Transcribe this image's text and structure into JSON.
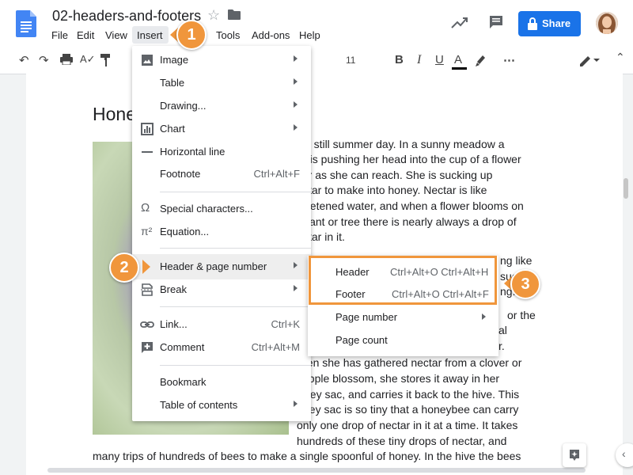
{
  "app": {
    "doc_title": "02-headers-and-footers",
    "share_label": "Share",
    "brand_color": "#1a73e8",
    "accent_color": "#f0963c"
  },
  "menubar": [
    "File",
    "Edit",
    "View",
    "Insert",
    "Tools",
    "Add-ons",
    "Help"
  ],
  "toolbar": {
    "font_size": "11"
  },
  "insert_menu": {
    "items": [
      {
        "label": "Image",
        "icon": "image-icon",
        "has_submenu": true
      },
      {
        "label": "Table",
        "icon": "",
        "has_submenu": true
      },
      {
        "label": "Drawing...",
        "icon": "",
        "has_submenu": true
      },
      {
        "label": "Chart",
        "icon": "chart-icon",
        "has_submenu": true
      },
      {
        "label": "Horizontal line",
        "icon": "horizontal-line-icon",
        "has_submenu": false
      },
      {
        "label": "Footnote",
        "icon": "",
        "shortcut": "Ctrl+Alt+F"
      },
      {
        "label": "Special characters...",
        "icon": "omega-icon"
      },
      {
        "label": "Equation...",
        "icon": "pi-icon"
      },
      {
        "label": "Header & page number",
        "icon": "",
        "has_submenu": true,
        "highlighted": true
      },
      {
        "label": "Break",
        "icon": "break-icon",
        "has_submenu": true
      },
      {
        "label": "Link...",
        "icon": "link-icon",
        "shortcut": "Ctrl+K"
      },
      {
        "label": "Comment",
        "icon": "add-comment-icon",
        "shortcut": "Ctrl+Alt+M"
      },
      {
        "label": "Bookmark",
        "icon": ""
      },
      {
        "label": "Table of contents",
        "icon": "",
        "has_submenu": true
      }
    ]
  },
  "submenu": {
    "items": [
      {
        "label": "Header",
        "shortcut": "Ctrl+Alt+O Ctrl+Alt+H"
      },
      {
        "label": "Footer",
        "shortcut": "Ctrl+Alt+O Ctrl+Alt+F"
      },
      {
        "label": "Page number",
        "has_submenu": true
      },
      {
        "label": "Page count"
      }
    ]
  },
  "callouts": [
    "1",
    "2",
    "3"
  ],
  "document": {
    "heading": "Hone",
    "lines": [
      "s a still summer day. In a sunny meadow a",
      "e is pushing her head into the cup of a flower",
      "far as she can reach. She is sucking up",
      "ctar to make into honey. Nectar is like",
      "eetened water, and when a flower blooms on",
      "lant or tree there is nearly always a drop of",
      "ctar in it.",
      "ng like",
      "suc",
      "ng.",
      "or the",
      "al",
      "r.",
      "hen she has gathered nectar from a clover or",
      "apple blossom, she stores it away in her",
      "ney sac, and carries it back to the hive. This",
      "ney sac is so tiny that a honeybee can carry",
      "only one drop of nectar in it at a time. It takes",
      "hundreds of these tiny drops of nectar, and",
      "many trips of hundreds of bees to make a single spoonful of honey. In the hive the bees"
    ]
  }
}
